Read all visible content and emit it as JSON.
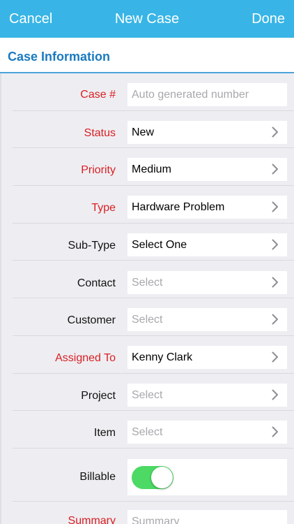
{
  "navbar": {
    "cancel_label": "Cancel",
    "title": "New Case",
    "done_label": "Done",
    "bar_color": "#38b5e6"
  },
  "section": {
    "title": "Case Information"
  },
  "form": {
    "rows": [
      {
        "label": "Case #",
        "required": true,
        "value": "Auto generated number",
        "placeholder": true,
        "chevron": false
      },
      {
        "label": "Status",
        "required": true,
        "value": "New",
        "placeholder": false,
        "chevron": true
      },
      {
        "label": "Priority",
        "required": true,
        "value": "Medium",
        "placeholder": false,
        "chevron": true
      },
      {
        "label": "Type",
        "required": true,
        "value": "Hardware Problem",
        "placeholder": false,
        "chevron": true
      },
      {
        "label": "Sub-Type",
        "required": false,
        "value": "Select One",
        "placeholder": false,
        "chevron": true
      },
      {
        "label": "Contact",
        "required": false,
        "value": "Select",
        "placeholder": true,
        "chevron": true
      },
      {
        "label": "Customer",
        "required": false,
        "value": "Select",
        "placeholder": true,
        "chevron": true
      },
      {
        "label": "Assigned To",
        "required": true,
        "value": "Kenny Clark",
        "placeholder": false,
        "chevron": true
      },
      {
        "label": "Project",
        "required": false,
        "value": "Select",
        "placeholder": true,
        "chevron": true
      },
      {
        "label": "Item",
        "required": false,
        "value": "Select",
        "placeholder": true,
        "chevron": true
      }
    ],
    "billable": {
      "label": "Billable",
      "on": true,
      "on_color": "#4cd964"
    },
    "summary": {
      "label": "Summary",
      "required": true,
      "placeholder": "Summary"
    }
  },
  "colors": {
    "required_label": "#d91f23",
    "section_title": "#1a7ac0"
  }
}
